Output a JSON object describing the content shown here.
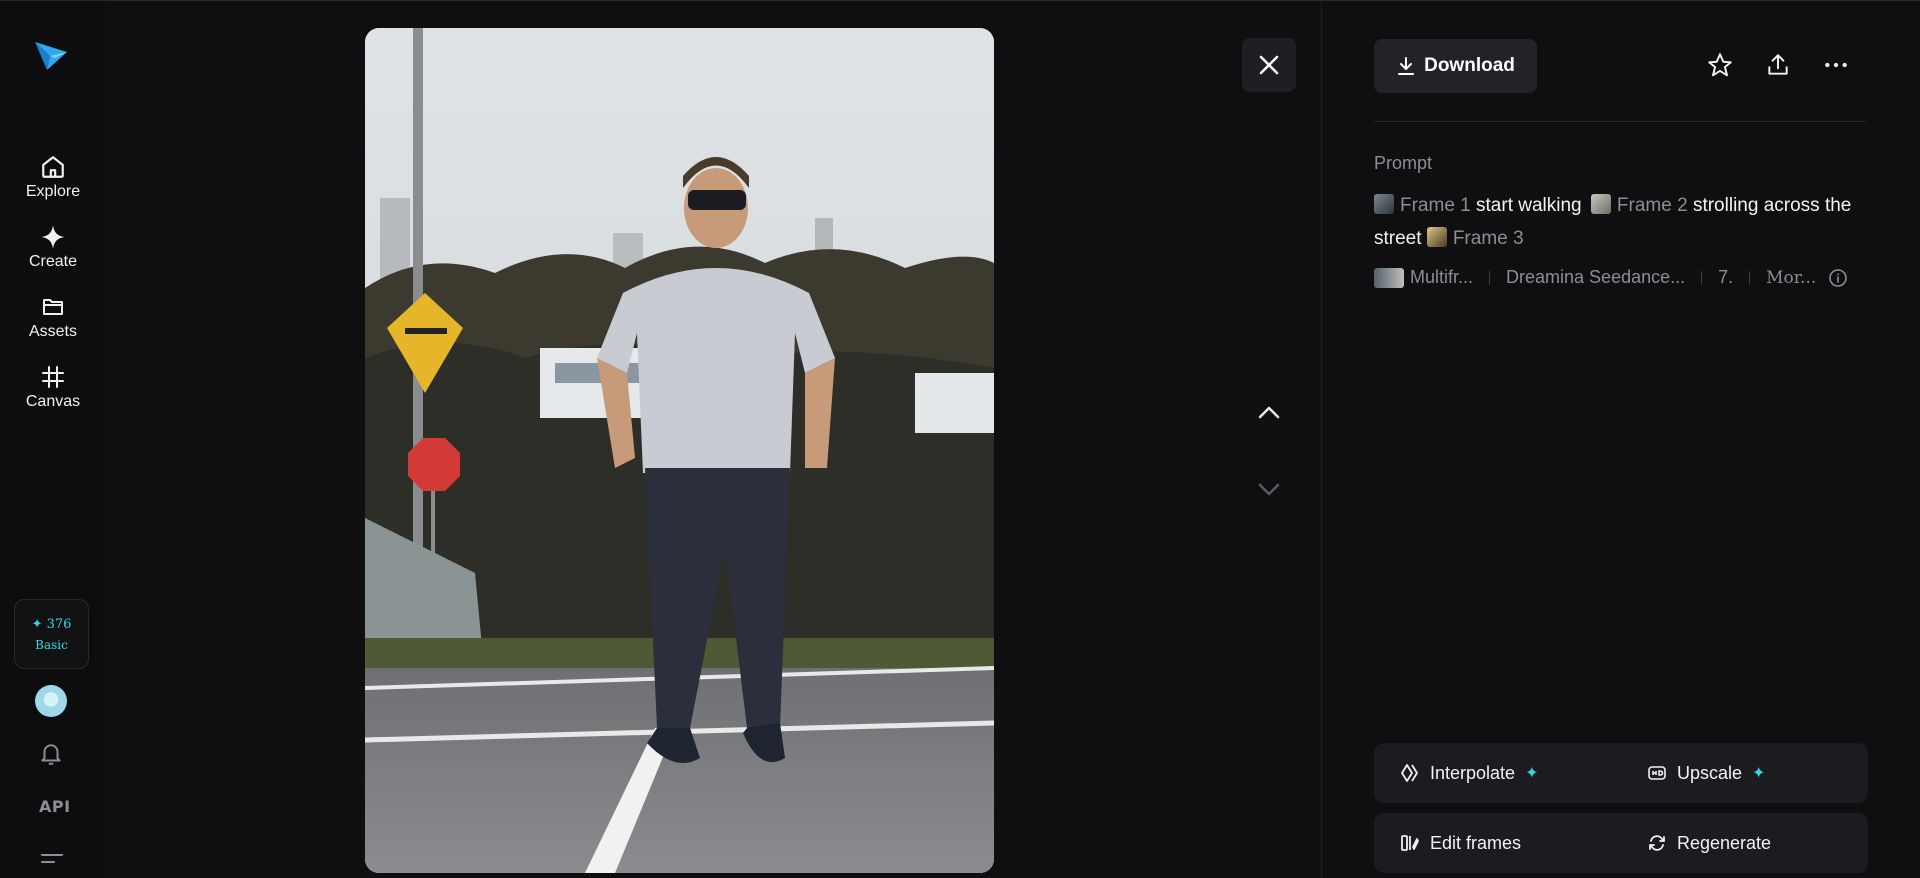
{
  "sidebar": {
    "items": [
      {
        "label": "Explore",
        "icon": "home-icon"
      },
      {
        "label": "Create",
        "icon": "sparkle-icon"
      },
      {
        "label": "Assets",
        "icon": "folder-icon"
      },
      {
        "label": "Canvas",
        "icon": "frame-icon"
      }
    ],
    "credits": {
      "count": "✦ 376",
      "plan": "Basic"
    },
    "api_label": "API"
  },
  "panel": {
    "download_label": "Download",
    "prompt_label": "Prompt",
    "prompt": {
      "frame1": "Frame 1",
      "text1": "start walking",
      "frame2": "Frame 2",
      "text2": "strolling across the street",
      "frame3": "Frame 3"
    },
    "meta": {
      "mode": "Multifr...",
      "model": "Dreamina Seedance...",
      "duration": "7.",
      "more": "Mor..."
    },
    "actions": {
      "interpolate": "Interpolate",
      "upscale": "Upscale",
      "edit_frames": "Edit frames",
      "regenerate": "Regenerate"
    }
  },
  "colors": {
    "accent": "#2fd8e8",
    "background": "#0f0f11",
    "button": "#232327"
  }
}
